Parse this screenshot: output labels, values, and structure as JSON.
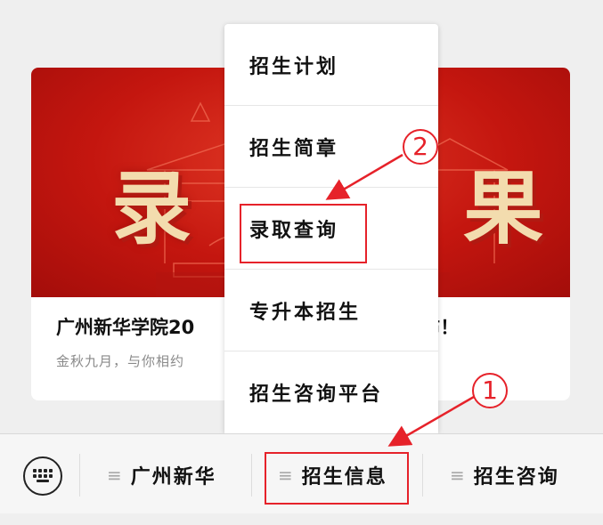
{
  "article": {
    "title_left": "广州新华学院20",
    "title_right": "公布！",
    "subtitle": "金秋九月，与你相约",
    "banner_left": "录",
    "banner_right": "果"
  },
  "menu": {
    "items": [
      {
        "label": "招生计划"
      },
      {
        "label": "招生简章"
      },
      {
        "label": "录取查询"
      },
      {
        "label": "专升本招生"
      },
      {
        "label": "招生咨询平台"
      }
    ]
  },
  "annotations": {
    "step1": "1",
    "step2": "2",
    "highlight_color": "#e6222a"
  },
  "bottom_bar": {
    "tabs": [
      {
        "label": "广州新华"
      },
      {
        "label": "招生信息"
      },
      {
        "label": "招生咨询"
      }
    ],
    "menu_glyph": "≡"
  }
}
